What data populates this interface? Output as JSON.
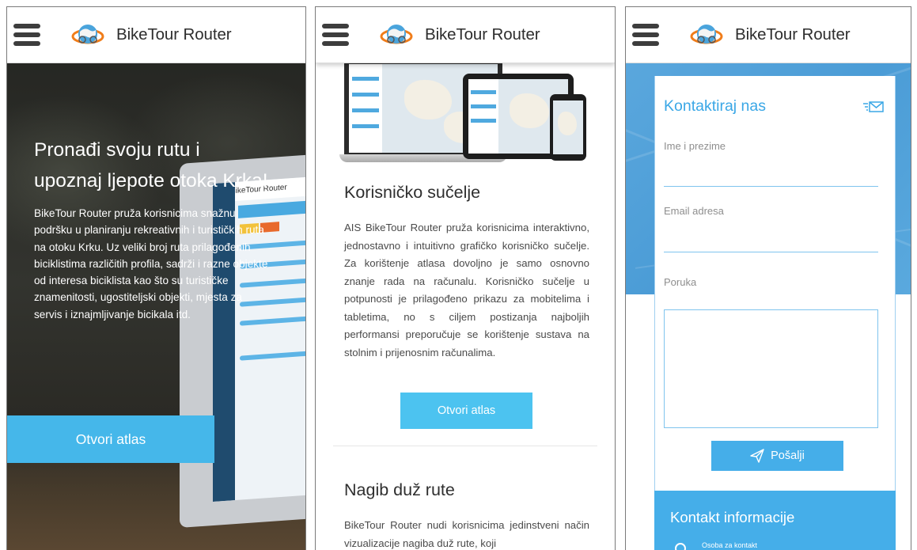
{
  "brand": {
    "name": "BikeTour Router",
    "accent": "#45b7ea"
  },
  "panel_home": {
    "hero_title": "Pronađi svoju rutu i upoznaj ljepote otoka Krka!",
    "hero_body": "BikeTour Router pruža korisnicima snažnu podršku u planiranju rekreativnih i turističkih ruta na otoku Krku. Uz veliki broj ruta prilagođenih biciklistima različitih profila, sadrži i razne objekte od interesa biciklista kao što su turističke znamenitosti, ugostiteljski objekti, mjesta za servis i iznajmljivanje bicikala itd.",
    "open_atlas": "Otvori atlas",
    "laptop_brand": "BikeTour Router"
  },
  "panel_features": {
    "section1_title": "Korisničko sučelje",
    "section1_body": "AIS BikeTour Router pruža korisnicima interaktivno, jednostavno i intuitivno grafičko korisničko sučelje. Za korištenje atlasa dovoljno je samo osnovno znanje rada na računalu. Korisničko sučelje u potpunosti je prilagođeno prikazu za mobitelima i tabletima, no s ciljem postizanja najboljih performansi preporučuje se korištenje sustava na stolnim i prijenosnim računalima.",
    "open_atlas": "Otvori atlas",
    "section2_title": "Nagib duž rute",
    "section2_body": "BikeTour Router nudi korisnicima jedinstveni način vizualizacije nagiba duž rute, koji"
  },
  "panel_contact": {
    "title": "Kontaktiraj nas",
    "name_label": "Ime i prezime",
    "email_label": "Email adresa",
    "message_label": "Poruka",
    "send_button": "Pošalji",
    "info_title": "Kontakt informacije",
    "contact_person": "Osoba za kontakt"
  }
}
